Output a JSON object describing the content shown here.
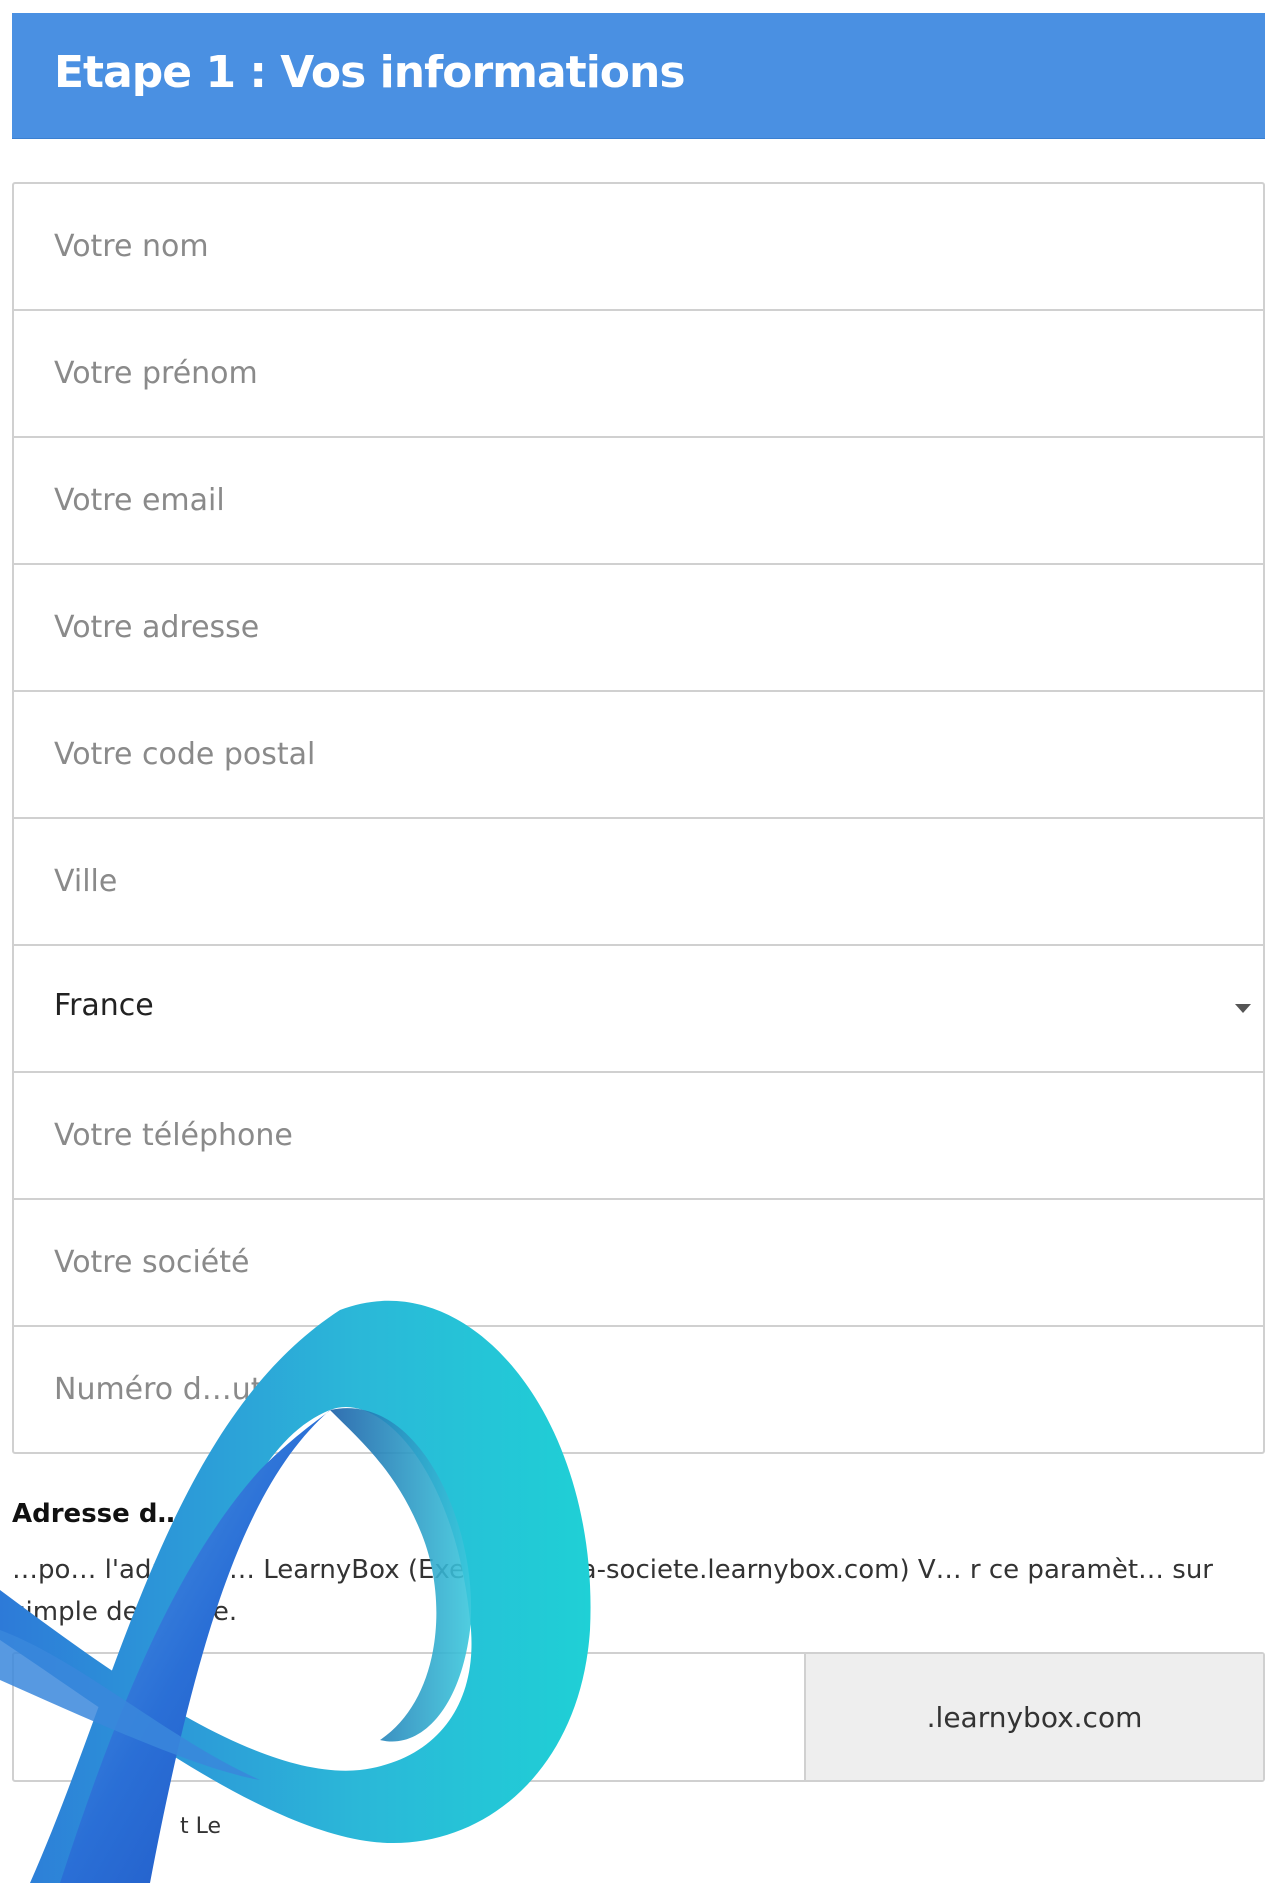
{
  "header": {
    "title": "Etape 1 : Vos informations"
  },
  "form": {
    "fields": [
      {
        "placeholder": "Votre nom"
      },
      {
        "placeholder": "Votre prénom"
      },
      {
        "placeholder": "Votre email"
      },
      {
        "placeholder": "Votre adresse"
      },
      {
        "placeholder": "Votre code postal"
      },
      {
        "placeholder": "Ville"
      }
    ],
    "country": {
      "selected": "France"
    },
    "fields2": [
      {
        "placeholder": "Votre téléphone"
      },
      {
        "placeholder": "Votre société"
      },
      {
        "placeholder": "Numéro d…utaire"
      }
    ]
  },
  "subdomain": {
    "title": "Adresse d… arn",
    "help": "…po… l'adresse … LearnyBox (Exemple : ma-societe.learnybox.com) V… r ce paramèt… sur simple demande.",
    "suffix": ".learnybox.com"
  },
  "consent": {
    "text": "t Le"
  },
  "colors": {
    "header_bg": "#4a90e2",
    "border": "#d0d0d0",
    "suffix_bg": "#eeeeee"
  }
}
